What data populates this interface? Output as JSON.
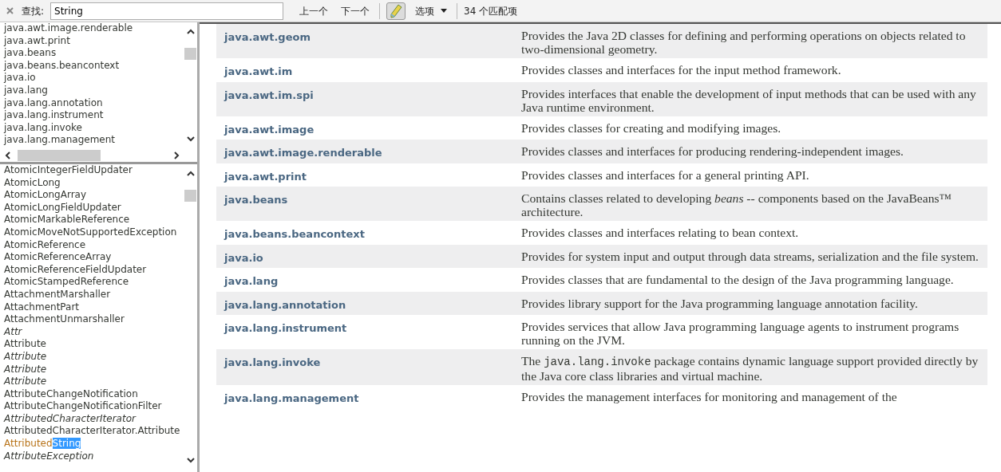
{
  "find_bar": {
    "label": "查找:",
    "value": "String",
    "prev": "上一个",
    "next": "下一个",
    "highlight_all": {
      "on": true
    },
    "options": "选项",
    "matches": "34 个匹配项"
  },
  "packages_frame": {
    "items": [
      {
        "text": "java.awt.image.renderable"
      },
      {
        "text": "java.awt.print"
      },
      {
        "text": "java.beans"
      },
      {
        "text": "java.beans.beancontext"
      },
      {
        "text": "java.io"
      },
      {
        "text": "java.lang"
      },
      {
        "text": "java.lang.annotation"
      },
      {
        "text": "java.lang.instrument"
      },
      {
        "text": "java.lang.invoke"
      },
      {
        "text": "java.lang.management"
      }
    ]
  },
  "classes_frame": {
    "items": [
      {
        "kind": "class",
        "text": "AtomicIntegerFieldUpdater"
      },
      {
        "kind": "class",
        "text": "AtomicLong"
      },
      {
        "kind": "class",
        "text": "AtomicLongArray"
      },
      {
        "kind": "class",
        "text": "AtomicLongFieldUpdater"
      },
      {
        "kind": "class",
        "text": "AtomicMarkableReference"
      },
      {
        "kind": "class",
        "text": "AtomicMoveNotSupportedException"
      },
      {
        "kind": "class",
        "text": "AtomicReference"
      },
      {
        "kind": "class",
        "text": "AtomicReferenceArray"
      },
      {
        "kind": "class",
        "text": "AtomicReferenceFieldUpdater"
      },
      {
        "kind": "class",
        "text": "AtomicStampedReference"
      },
      {
        "kind": "class",
        "text": "AttachmentMarshaller"
      },
      {
        "kind": "class",
        "text": "AttachmentPart"
      },
      {
        "kind": "class",
        "text": "AttachmentUnmarshaller"
      },
      {
        "kind": "interface",
        "text": "Attr"
      },
      {
        "kind": "class",
        "text": "Attribute"
      },
      {
        "kind": "interface",
        "text": "Attribute"
      },
      {
        "kind": "interface",
        "text": "Attribute"
      },
      {
        "kind": "interface",
        "text": "Attribute"
      },
      {
        "kind": "class",
        "text": "AttributeChangeNotification"
      },
      {
        "kind": "class",
        "text": "AttributeChangeNotificationFilter"
      },
      {
        "kind": "interface",
        "text": "AttributedCharacterIterator"
      },
      {
        "kind": "class",
        "text": "AttributedCharacterIterator.Attribute"
      },
      {
        "kind": "match",
        "text": "Attributed",
        "hit": "String"
      },
      {
        "kind": "interface",
        "text": "AttributeException"
      }
    ]
  },
  "packages_table": {
    "rows": [
      {
        "package": "java.awt.geom",
        "description": "Provides the Java 2D classes for defining and performing operations on objects related to two-dimensional geometry."
      },
      {
        "package": "java.awt.im",
        "description": "Provides classes and interfaces for the input method framework."
      },
      {
        "package": "java.awt.im.spi",
        "description": "Provides interfaces that enable the development of input methods that can be used with any Java runtime environment."
      },
      {
        "package": "java.awt.image",
        "description": "Provides classes for creating and modifying images."
      },
      {
        "package": "java.awt.image.renderable",
        "description": "Provides classes and interfaces for producing rendering-independent images."
      },
      {
        "package": "java.awt.print",
        "description": "Provides classes and interfaces for a general printing API."
      },
      {
        "package": "java.beans",
        "description": "Contains classes related to developing *beans* -- components based on the JavaBeans™ architecture."
      },
      {
        "package": "java.beans.beancontext",
        "description": "Provides classes and interfaces relating to bean context."
      },
      {
        "package": "java.io",
        "description": "Provides for system input and output through data streams, serialization and the file system."
      },
      {
        "package": "java.lang",
        "description": "Provides classes that are fundamental to the design of the Java programming language."
      },
      {
        "package": "java.lang.annotation",
        "description": "Provides library support for the Java programming language annotation facility."
      },
      {
        "package": "java.lang.instrument",
        "description": "Provides services that allow Java programming language agents to instrument programs running on the JVM."
      },
      {
        "package": "java.lang.invoke",
        "description_before": "The",
        "code": "java.lang.invoke",
        "description": "package contains dynamic language support provided directly by the Java core class libraries and virtual machine."
      },
      {
        "package": "java.lang.management",
        "description": "Provides the management interfaces for monitoring and management of the"
      }
    ]
  }
}
